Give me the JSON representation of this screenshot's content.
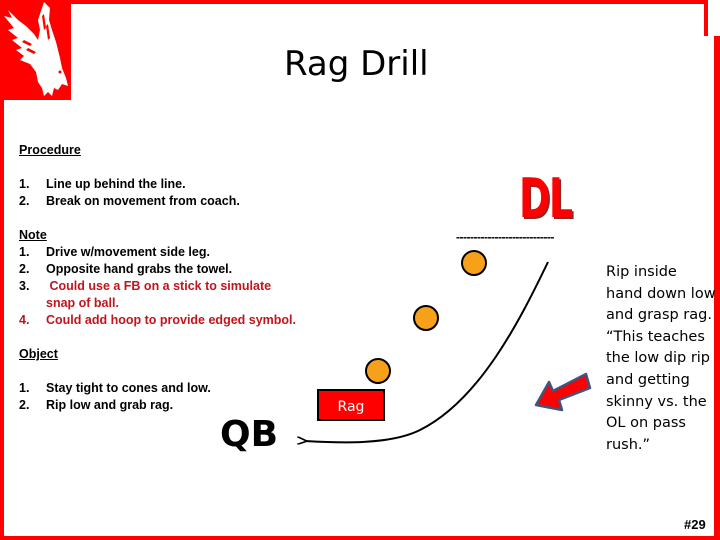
{
  "title": "Rag Drill",
  "logo": {
    "icon": "falcon-logo-icon",
    "color": "#ff0000"
  },
  "procedure": {
    "heading": "Procedure",
    "items": [
      {
        "num": "1.",
        "text": "Line up behind the line."
      },
      {
        "num": "2.",
        "text": "Break on movement from coach."
      }
    ]
  },
  "note": {
    "heading": "Note",
    "items": [
      {
        "num": "1.",
        "text": "Drive w/movement side leg.",
        "highlight": false
      },
      {
        "num": "2.",
        "text": "Opposite hand grabs the towel.",
        "highlight": false
      },
      {
        "num": "3.",
        "text": " Could use a FB on a stick to simulate snap of ball.",
        "highlight": true
      },
      {
        "num": "4.",
        "text": "Could add hoop to provide edged symbol.",
        "highlight": true
      }
    ]
  },
  "object": {
    "heading": "Object",
    "items": [
      {
        "num": "1.",
        "text": "Stay tight to cones and low."
      },
      {
        "num": "2.",
        "text": "Rip low and grab rag."
      }
    ]
  },
  "diagram": {
    "dl_label": "DL",
    "line_of_scrimmage": "----------------------------",
    "qb_label": "QB",
    "rag_label": "Rag",
    "cone_count": 3,
    "colors": {
      "cone": "#f7a11a",
      "rag": "#ff0000",
      "arrow": "#ff0000",
      "arrow_outline": "#3f5480",
      "accent": "#ff0000"
    }
  },
  "coaching_point": "Rip inside hand down low and grasp rag.  “This teaches the low dip rip and getting skinny vs. the OL on  pass rush.”",
  "slide_number": "#29"
}
